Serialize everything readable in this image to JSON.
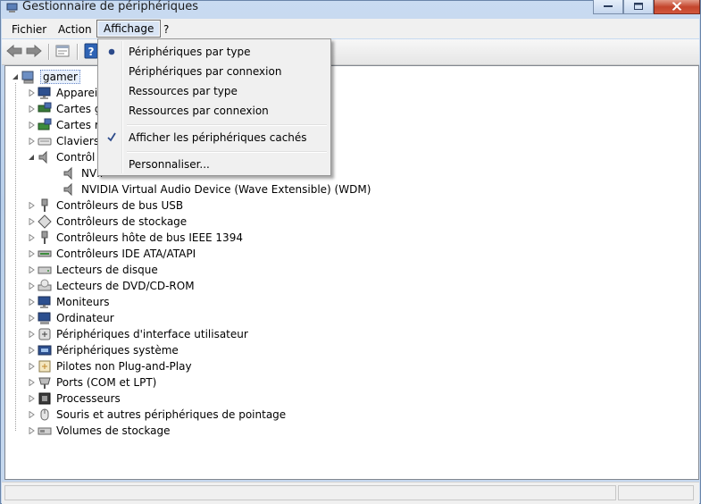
{
  "window": {
    "title": "Gestionnaire de périphériques"
  },
  "menubar": {
    "items": [
      "Fichier",
      "Action",
      "Affichage",
      "?"
    ]
  },
  "affichage_menu": {
    "items": [
      {
        "label": "Périphériques par type",
        "mark": "radio-bullet"
      },
      {
        "label": "Périphériques par connexion",
        "mark": ""
      },
      {
        "label": "Ressources par type",
        "mark": ""
      },
      {
        "label": "Ressources par connexion",
        "mark": ""
      },
      {
        "label": "Afficher les périphériques cachés",
        "mark": "checkmark"
      },
      {
        "label": "Personnaliser...",
        "mark": ""
      }
    ]
  },
  "tree": {
    "root": "gamer",
    "items": [
      {
        "label": "Appareil",
        "icon": "monitor-icon",
        "depth": 1,
        "expander": "collapsed"
      },
      {
        "label": "Cartes g",
        "icon": "display-adapter-icon",
        "depth": 1,
        "expander": "collapsed"
      },
      {
        "label": "Cartes r",
        "icon": "network-adapter-icon",
        "depth": 1,
        "expander": "collapsed"
      },
      {
        "label": "Claviers",
        "icon": "keyboard-icon",
        "depth": 1,
        "expander": "collapsed"
      },
      {
        "label": "Contrôl",
        "icon": "speaker-icon",
        "depth": 1,
        "expander": "expanded"
      },
      {
        "label": "NVII",
        "icon": "speaker-icon",
        "depth": 2,
        "expander": ""
      },
      {
        "label": "NVIDIA Virtual Audio Device (Wave Extensible) (WDM)",
        "icon": "speaker-icon",
        "depth": 2,
        "expander": ""
      },
      {
        "label": "Contrôleurs de bus USB",
        "icon": "usb-icon",
        "depth": 1,
        "expander": "collapsed"
      },
      {
        "label": "Contrôleurs de stockage",
        "icon": "storage-controller-icon",
        "depth": 1,
        "expander": "collapsed"
      },
      {
        "label": "Contrôleurs hôte de bus IEEE 1394",
        "icon": "firewire-icon",
        "depth": 1,
        "expander": "collapsed"
      },
      {
        "label": "Contrôleurs IDE ATA/ATAPI",
        "icon": "ide-icon",
        "depth": 1,
        "expander": "collapsed"
      },
      {
        "label": "Lecteurs de disque",
        "icon": "disk-drive-icon",
        "depth": 1,
        "expander": "collapsed"
      },
      {
        "label": "Lecteurs de DVD/CD-ROM",
        "icon": "dvd-drive-icon",
        "depth": 1,
        "expander": "collapsed"
      },
      {
        "label": "Moniteurs",
        "icon": "monitor-icon",
        "depth": 1,
        "expander": "collapsed"
      },
      {
        "label": "Ordinateur",
        "icon": "computer-icon",
        "depth": 1,
        "expander": "collapsed"
      },
      {
        "label": "Périphériques d'interface utilisateur",
        "icon": "hid-icon",
        "depth": 1,
        "expander": "collapsed"
      },
      {
        "label": "Périphériques système",
        "icon": "system-device-icon",
        "depth": 1,
        "expander": "collapsed"
      },
      {
        "label": "Pilotes non Plug-and-Play",
        "icon": "driver-icon",
        "depth": 1,
        "expander": "collapsed"
      },
      {
        "label": "Ports (COM et LPT)",
        "icon": "port-icon",
        "depth": 1,
        "expander": "collapsed"
      },
      {
        "label": "Processeurs",
        "icon": "processor-icon",
        "depth": 1,
        "expander": "collapsed"
      },
      {
        "label": "Souris et autres périphériques de pointage",
        "icon": "mouse-icon",
        "depth": 1,
        "expander": "collapsed"
      },
      {
        "label": "Volumes de stockage",
        "icon": "volume-icon",
        "depth": 1,
        "expander": "collapsed"
      }
    ]
  },
  "colors": {
    "selection": "#3d6cc4",
    "menu_bg": "#f0f0f0",
    "window_frame": "#c9dbf1"
  }
}
